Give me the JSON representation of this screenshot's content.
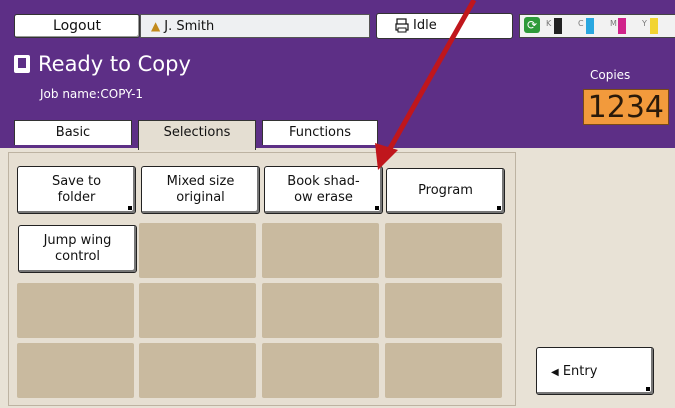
{
  "topbar": {
    "logout_label": "Logout",
    "user_name": "J. Smith",
    "status_text": "Idle",
    "ink_labels": [
      "K",
      "C",
      "M",
      "Y"
    ],
    "ink_colors": [
      "#222222",
      "#2aa7e0",
      "#d0238a",
      "#f2d431"
    ]
  },
  "header": {
    "title": "Ready to Copy",
    "job_name": "Job name:COPY-1",
    "copies_label": "Copies",
    "copies_value": "1234"
  },
  "tabs": [
    {
      "label": "Basic"
    },
    {
      "label": "Selections"
    },
    {
      "label": "Functions"
    }
  ],
  "functions": [
    {
      "label": "Save to folder"
    },
    {
      "label": "Mixed size original"
    },
    {
      "label": "Book shad-ow erase"
    },
    {
      "label": "Program"
    },
    {
      "label": "Jump wing control"
    }
  ],
  "entry_label": "Entry",
  "colors": {
    "header_purple": "#5d2f86",
    "copies_orange": "#f29a3c",
    "annotation_arrow": "#c0161c"
  }
}
